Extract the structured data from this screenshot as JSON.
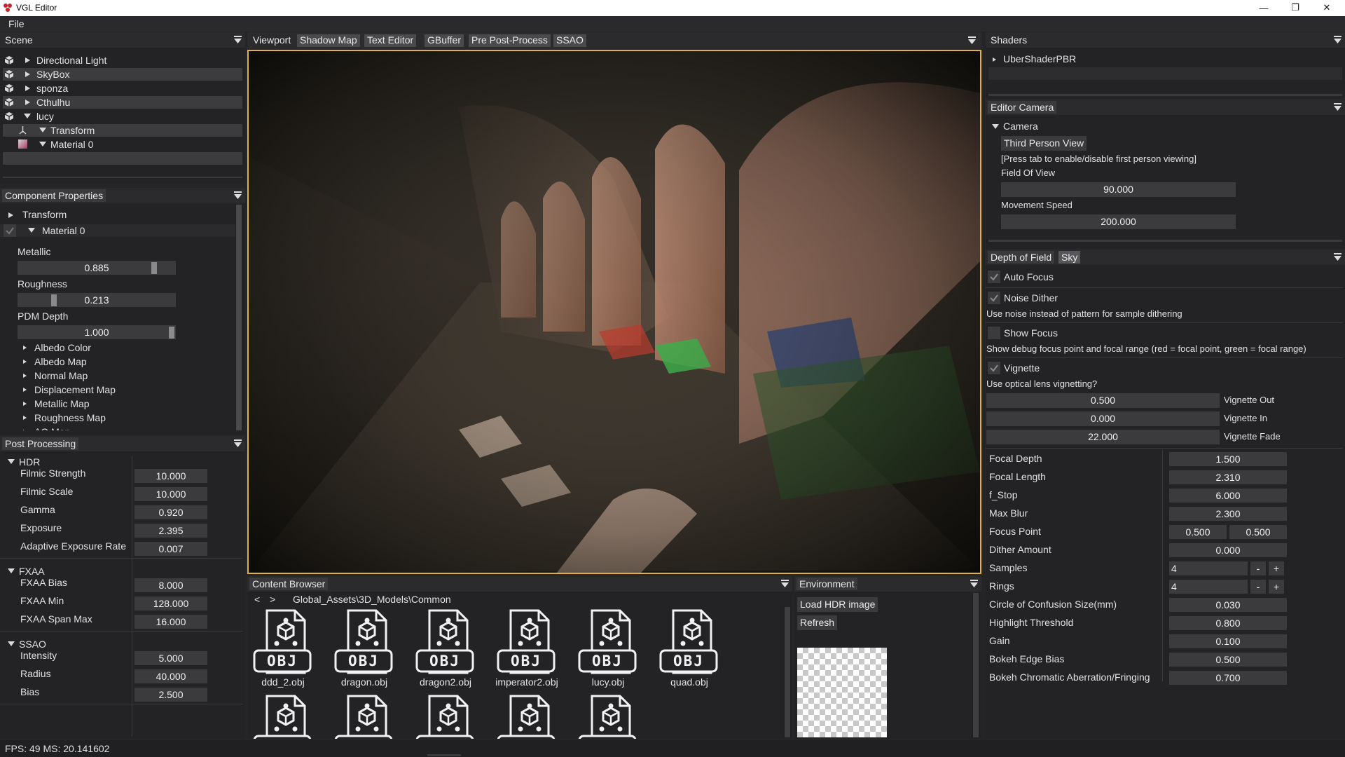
{
  "window": {
    "title": "VGL Editor",
    "minimize": "—",
    "restore": "❐",
    "close": "✕"
  },
  "menu": {
    "file": "File"
  },
  "scene": {
    "tab": "Scene",
    "items": [
      {
        "label": "Directional Light",
        "icon": "cube-icon"
      },
      {
        "label": "SkyBox",
        "icon": "cube-icon"
      },
      {
        "label": "sponza",
        "icon": "cube-icon"
      },
      {
        "label": "Cthulhu",
        "icon": "cube-icon"
      },
      {
        "label": "lucy",
        "icon": "cube-icon"
      }
    ],
    "children": [
      {
        "label": "Transform",
        "icon": "transform-icon"
      },
      {
        "label": "Material 0",
        "icon": "material-icon"
      }
    ]
  },
  "component": {
    "tab": "Component Properties",
    "transform": "Transform",
    "material": "Material 0",
    "metallic_label": "Metallic",
    "metallic_value": "0.885",
    "metallic": 0.885,
    "roughness_label": "Roughness",
    "roughness_value": "0.213",
    "roughness": 0.213,
    "pdm_label": "PDM Depth",
    "pdm_value": "1.000",
    "pdm": 1.0,
    "maps": [
      "Albedo Color",
      "Albedo Map",
      "Normal Map",
      "Displacement Map",
      "Metallic Map",
      "Roughness Map",
      "AO Map"
    ]
  },
  "post": {
    "tab": "Post Processing",
    "hdr": {
      "title": "HDR",
      "rows": [
        {
          "label": "Filmic Strength",
          "value": "10.000"
        },
        {
          "label": "Filmic Scale",
          "value": "10.000"
        },
        {
          "label": "Gamma",
          "value": "0.920"
        },
        {
          "label": "Exposure",
          "value": "2.395"
        },
        {
          "label": "Adaptive Exposure Rate",
          "value": "0.007"
        }
      ]
    },
    "fxaa": {
      "title": "FXAA",
      "rows": [
        {
          "label": "FXAA Bias",
          "value": "8.000"
        },
        {
          "label": "FXAA Min",
          "value": "128.000"
        },
        {
          "label": "FXAA Span Max",
          "value": "16.000"
        }
      ]
    },
    "ssao": {
      "title": "SSAO",
      "rows": [
        {
          "label": "Intensity",
          "value": "5.000"
        },
        {
          "label": "Radius",
          "value": "40.000"
        },
        {
          "label": "Bias",
          "value": "2.500"
        }
      ]
    }
  },
  "center_tabs": [
    "Viewport",
    "Shadow Map",
    "Text Editor",
    "GBuffer",
    "Pre Post-Process",
    "SSAO"
  ],
  "content": {
    "tab": "Content Browser",
    "back": "<",
    "forward": ">",
    "path": "Global_Assets\\3D_Models\\Common",
    "files": [
      "ddd_2.obj",
      "dragon.obj",
      "dragon2.obj",
      "imperator2.obj",
      "lucy.obj",
      "quad.obj"
    ],
    "badge": "OBJ"
  },
  "environment": {
    "tab": "Environment",
    "load": "Load HDR image",
    "refresh": "Refresh"
  },
  "shaders": {
    "tab": "Shaders",
    "item": "UberShaderPBR"
  },
  "camera": {
    "tab": "Editor Camera",
    "section": "Camera",
    "mode_button": "Third Person View",
    "hint": "[Press tab to enable/disable first person viewing]",
    "fov_label": "Field Of View",
    "fov_value": "90.000",
    "speed_label": "Movement Speed",
    "speed_value": "200.000"
  },
  "dof": {
    "tabs": [
      "Depth of Field",
      "Sky"
    ],
    "auto_focus": "Auto Focus",
    "noise_dither": "Noise Dither",
    "noise_desc": "Use noise instead of pattern for sample dithering",
    "show_focus": "Show Focus",
    "show_focus_desc": "Show debug focus point and focal range (red = focal point, green = focal range)",
    "vignette": "Vignette",
    "vignette_desc": "Use optical lens vignetting?",
    "vignette_out_value": "0.500",
    "vignette_out": "Vignette Out",
    "vignette_in_value": "0.000",
    "vignette_in": "Vignette In",
    "vignette_fade_value": "22.000",
    "vignette_fade": "Vignette Fade",
    "params": [
      {
        "label": "Focal Depth",
        "value": "1.500"
      },
      {
        "label": "Focal Length",
        "value": "2.310"
      },
      {
        "label": "f_Stop",
        "value": "6.000"
      },
      {
        "label": "Max Blur",
        "value": "2.300"
      }
    ],
    "focus_point_label": "Focus Point",
    "focus_point_x": "0.500",
    "focus_point_y": "0.500",
    "dither_label": "Dither Amount",
    "dither_value": "0.000",
    "samples_label": "Samples",
    "samples_value": "4",
    "rings_label": "Rings",
    "rings_value": "4",
    "minus": "-",
    "plus": "+",
    "params2": [
      {
        "label": "Circle of Confusion Size(mm)",
        "value": "0.030"
      },
      {
        "label": "Highlight Threshold",
        "value": "0.800"
      },
      {
        "label": "Gain",
        "value": "0.100"
      },
      {
        "label": "Bokeh Edge Bias",
        "value": "0.500"
      },
      {
        "label": "Bokeh Chromatic Aberration/Fringing",
        "value": "0.700"
      }
    ]
  },
  "status": {
    "fps": "FPS: 49   MS: 20.141602"
  },
  "colors": {
    "accent_border": "#e0b14a",
    "panel_bg": "#232325",
    "field_bg": "#3b3b3e"
  }
}
